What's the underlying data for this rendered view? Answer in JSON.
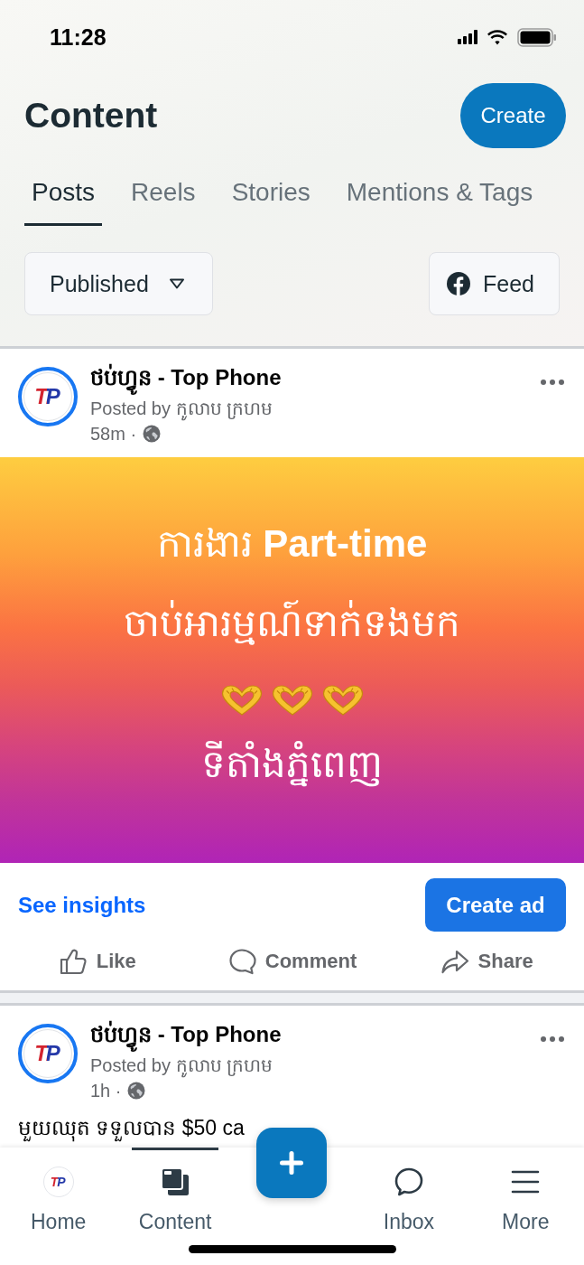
{
  "status_bar": {
    "time": "11:28"
  },
  "header": {
    "title": "Content",
    "create_button": "Create"
  },
  "tabs": [
    {
      "label": "Posts",
      "selected": true
    },
    {
      "label": "Reels",
      "selected": false
    },
    {
      "label": "Stories",
      "selected": false
    },
    {
      "label": "Mentions & Tags",
      "selected": false
    }
  ],
  "filters": {
    "status_dropdown": "Published",
    "placement_button": "Feed"
  },
  "posts": [
    {
      "kind": "image",
      "page_name": "ថប់ហ្វូន - Top Phone",
      "avatar_logo": "TP",
      "posted_by": "Posted by កូលាប ក្រហម",
      "time": "58m ·",
      "image_lines": [
        {
          "kind": "text",
          "text": "ការងារ **Part-time**"
        },
        {
          "kind": "text",
          "text": "ចាប់អារម្មណ៍ទាក់ទងមក"
        },
        {
          "kind": "heart-hands"
        },
        {
          "kind": "text",
          "text": "ទីតាំងភ្នំពេញ"
        }
      ],
      "insights_link": "See insights",
      "ad_button": "Create ad",
      "actions": [
        {
          "kind": "like",
          "label": "Like"
        },
        {
          "kind": "comment",
          "label": "Comment"
        },
        {
          "kind": "share",
          "label": "Share"
        }
      ]
    },
    {
      "kind": "text",
      "page_name": "ថប់ហ្វូន - Top Phone",
      "avatar_logo": "TP",
      "posted_by": "Posted by កូលាប ក្រហម",
      "time": "1h ·",
      "text": "មួយឈុត ទទួលបាន $50 ca"
    }
  ],
  "bottom_nav": [
    {
      "kind": "home",
      "label": "Home",
      "logo": "TP",
      "selected": false
    },
    {
      "kind": "content",
      "label": "Content",
      "selected": true
    },
    {
      "kind": "add",
      "selected": false
    },
    {
      "kind": "inbox",
      "label": "Inbox",
      "selected": false
    },
    {
      "kind": "more",
      "label": "More",
      "selected": false
    }
  ]
}
